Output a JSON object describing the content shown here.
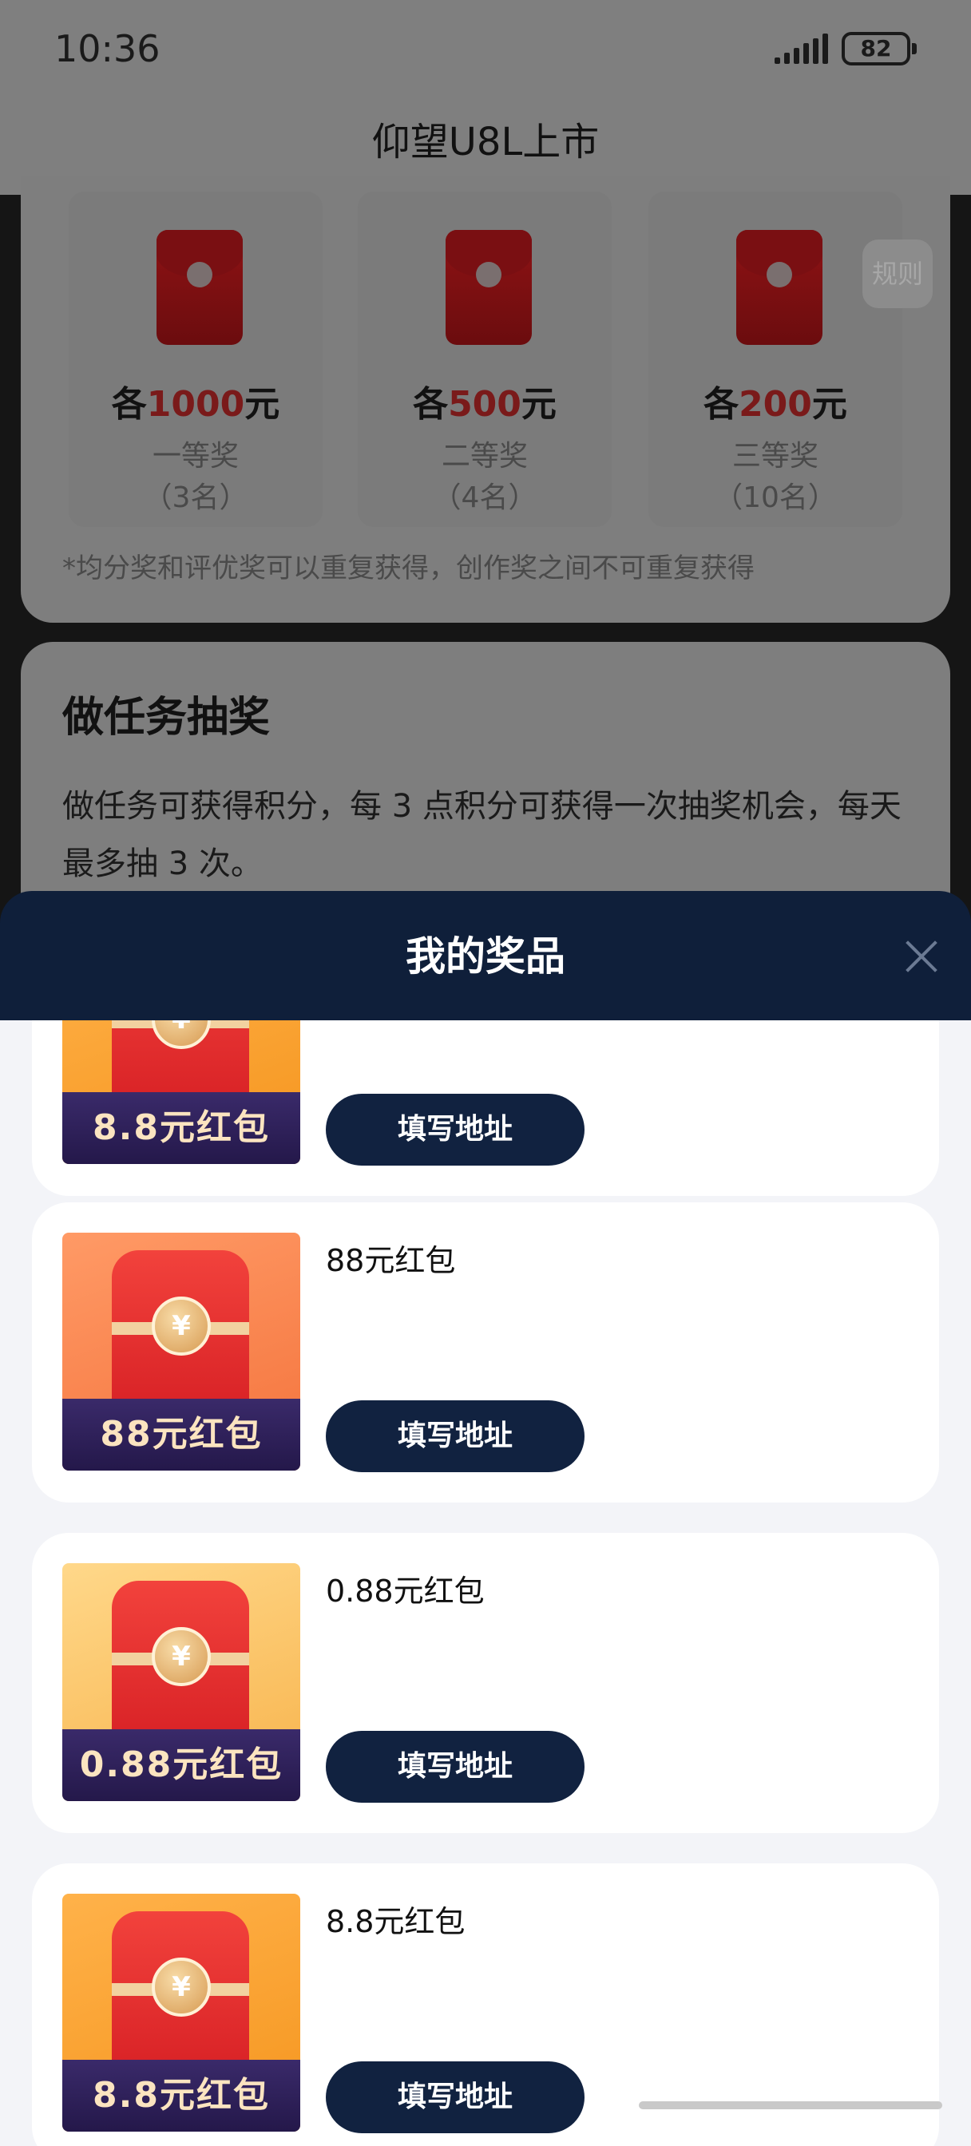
{
  "status_bar": {
    "time": "10:36",
    "battery": "82"
  },
  "app": {
    "title": "仰望U8L上市"
  },
  "prize_pool": {
    "rule_button": "规则",
    "prizes": [
      {
        "prefix": "各",
        "amount": "1000",
        "unit": "元",
        "rank": "一等奖",
        "count": "（3名）"
      },
      {
        "prefix": "各",
        "amount": "500",
        "unit": "元",
        "rank": "二等奖",
        "count": "（4名）"
      },
      {
        "prefix": "各",
        "amount": "200",
        "unit": "元",
        "rank": "三等奖",
        "count": "（10名）"
      }
    ],
    "note": "*均分奖和评优奖可以重复获得，创作奖之间不可重复获得"
  },
  "task_section": {
    "title": "做任务抽奖",
    "desc": "做任务可获得积分，每 3 点积分可获得一次抽奖机会，每天最多抽 3 次。"
  },
  "my_prizes": {
    "title": "我的奖品",
    "items": [
      {
        "thumb_label": "8.8元红包",
        "name": "",
        "button": "填写地址",
        "theme": "amber"
      },
      {
        "thumb_label": "88元红包",
        "name": "88元红包",
        "button": "填写地址",
        "theme": "orange"
      },
      {
        "thumb_label": "0.88元红包",
        "name": "0.88元红包",
        "button": "填写地址",
        "theme": "yellow"
      },
      {
        "thumb_label": "8.8元红包",
        "name": "8.8元红包",
        "button": "填写地址",
        "theme": "amber"
      }
    ]
  },
  "icons": {
    "coin_symbol": "¥"
  },
  "colors": {
    "sheet_header": "#0f1f3a",
    "button": "#112240",
    "accent_red": "#d61f24"
  }
}
